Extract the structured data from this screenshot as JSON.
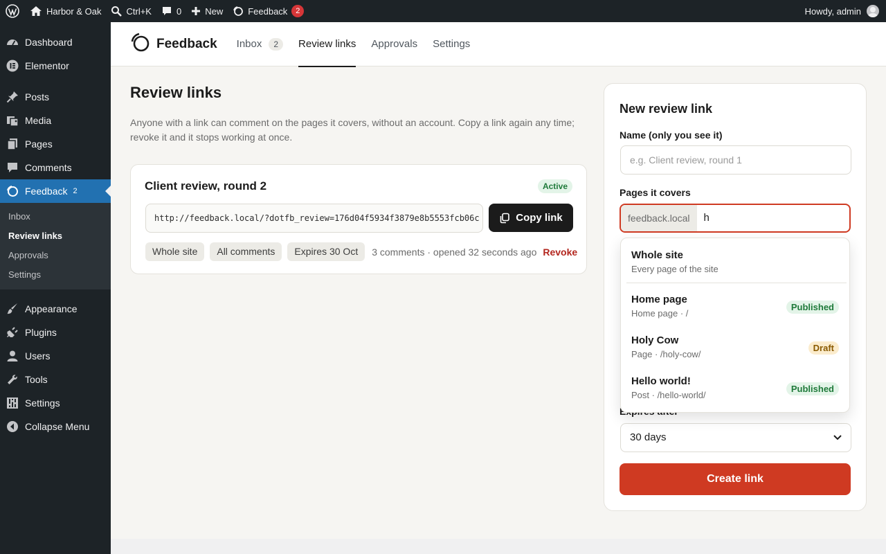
{
  "adminbar": {
    "site_name": "Harbor & Oak",
    "search_shortcut": "Ctrl+K",
    "comments_count": "0",
    "new_label": "New",
    "feedback_label": "Feedback",
    "feedback_count": "2",
    "howdy": "Howdy, admin"
  },
  "sidebar": {
    "dashboard": "Dashboard",
    "elementor": "Elementor",
    "posts": "Posts",
    "media": "Media",
    "pages": "Pages",
    "comments": "Comments",
    "feedback": "Feedback",
    "feedback_count": "2",
    "submenu": [
      "Inbox",
      "Review links",
      "Approvals",
      "Settings"
    ],
    "appearance": "Appearance",
    "plugins": "Plugins",
    "users": "Users",
    "tools": "Tools",
    "settings": "Settings",
    "collapse": "Collapse Menu"
  },
  "header": {
    "brand": "Feedback",
    "tabs": [
      {
        "label": "Inbox",
        "count": "2"
      },
      {
        "label": "Review links"
      },
      {
        "label": "Approvals"
      },
      {
        "label": "Settings"
      }
    ]
  },
  "main": {
    "title": "Review links",
    "description": "Anyone with a link can comment on the pages it covers, without an account. Copy a link again any time; revoke it and it stops working at once.",
    "links": [
      {
        "name": "Client review, round 2",
        "status": "Active",
        "url": "http://feedback.local/?dotfb_review=176d04f5934f3879e8b5553fcb06c",
        "copy_label": "Copy link",
        "tags": [
          "Whole site",
          "All comments",
          "Expires 30 Oct"
        ],
        "meta": "3 comments · opened 32 seconds ago",
        "revoke_label": "Revoke"
      }
    ]
  },
  "form": {
    "title": "New review link",
    "name_label": "Name (only you see it)",
    "name_placeholder": "e.g. Client review, round 1",
    "pages_label": "Pages it covers",
    "pages_prefix": "feedback.local",
    "pages_query": "h",
    "expires_label": "Expires after",
    "expires_value": "30 days",
    "submit_label": "Create link"
  },
  "dropdown": {
    "options": [
      {
        "title": "Whole site",
        "subtitle": "Every page of the site"
      },
      {
        "title": "Home page",
        "subtitle": "Home page · /",
        "badge": "Published"
      },
      {
        "title": "Holy Cow",
        "subtitle": "Page · /holy-cow/",
        "badge": "Draft"
      },
      {
        "title": "Hello world!",
        "subtitle": "Post · /hello-world/",
        "badge": "Published"
      }
    ]
  },
  "colors": {
    "accent": "#cf3a22",
    "wp_blue": "#2271b1",
    "admin_dark": "#1d2327",
    "active_green": "#1f7a3a"
  }
}
